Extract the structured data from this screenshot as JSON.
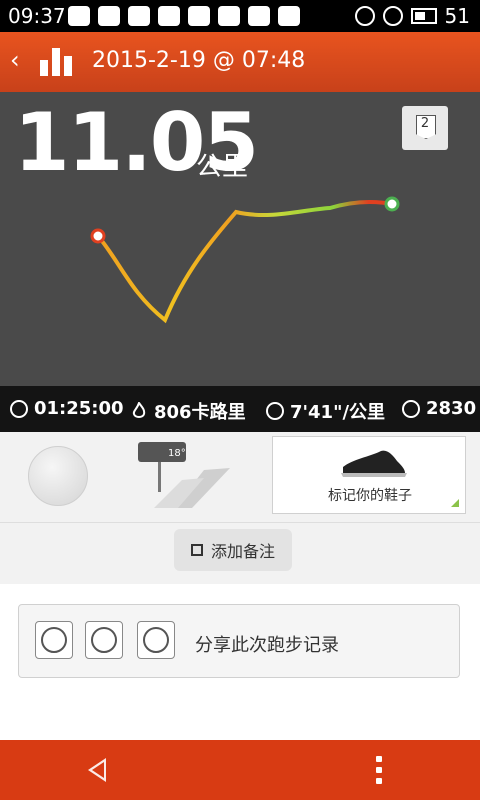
{
  "status_bar": {
    "time": "09:37",
    "signal": "51"
  },
  "header": {
    "title": "2015-2-19 @ 07:48",
    "back_icon": "chevron-left-icon",
    "menu_icon": "bars-chart-icon"
  },
  "run": {
    "distance": "11.05",
    "unit": "公里",
    "badge_number": "2"
  },
  "stats": {
    "duration": "01:25:00",
    "calories": "806卡路里",
    "pace": "7'41\"/公里",
    "fuel": "2830"
  },
  "shoe": {
    "label": "标记你的鞋子",
    "weather_temp": "18°"
  },
  "note": {
    "label": "添加备注"
  },
  "share": {
    "label": "分享此次跑步记录"
  },
  "colors": {
    "brand": "#d83b13",
    "map_bg": "#4a4a4a"
  }
}
